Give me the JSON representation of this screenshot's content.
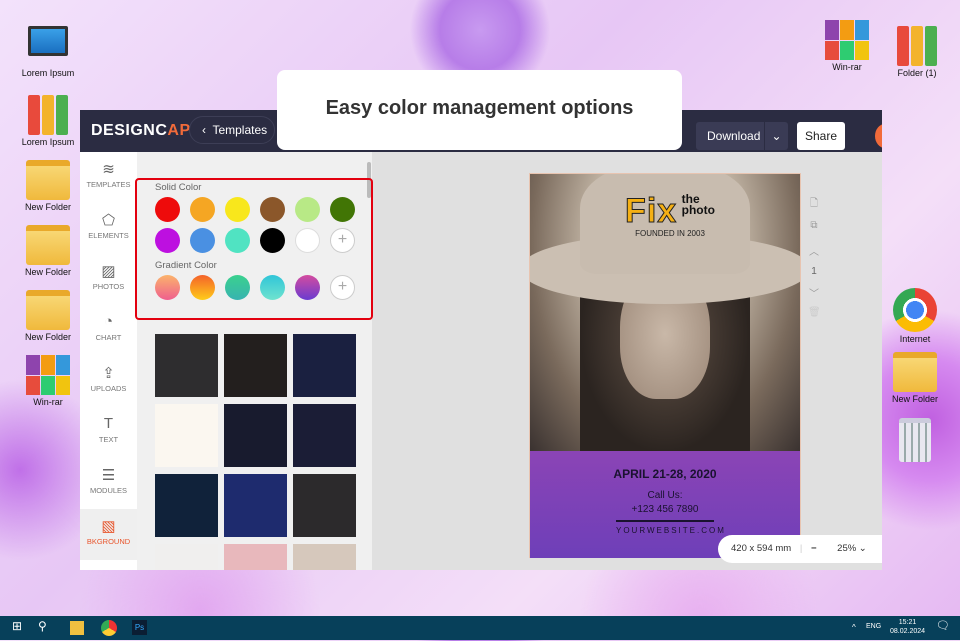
{
  "desktop": {
    "left": [
      {
        "label": "Lorem Ipsum",
        "icon": "computer-icon"
      },
      {
        "label": "Lorem Ipsum",
        "icon": "binders-icon"
      },
      {
        "label": "New Folder",
        "icon": "folder-icon"
      },
      {
        "label": "New Folder",
        "icon": "folder-icon"
      },
      {
        "label": "New Folder",
        "icon": "folder-icon"
      },
      {
        "label": "Win-rar",
        "icon": "winrar-icon"
      }
    ],
    "right": [
      {
        "label": "Win-rar",
        "icon": "winrar-icon"
      },
      {
        "label": "Folder (1)",
        "icon": "binders-icon"
      },
      {
        "label": "Internet",
        "icon": "chrome-icon"
      },
      {
        "label": "New Folder",
        "icon": "folder-icon"
      },
      {
        "label": "",
        "icon": "recycle-bin-icon"
      }
    ]
  },
  "callout": "Easy color management options",
  "app": {
    "logo_a": "DESIGNC",
    "logo_b": "AP",
    "templates_btn": "Templates",
    "download": "Download",
    "share": "Share"
  },
  "sidebar": [
    {
      "label": "TEMPLATES",
      "icon": "≋"
    },
    {
      "label": "ELEMENTS",
      "icon": "⬠"
    },
    {
      "label": "PHOTOS",
      "icon": "▨"
    },
    {
      "label": "CHART",
      "icon": "◔"
    },
    {
      "label": "UPLOADS",
      "icon": "⇪"
    },
    {
      "label": "TEXT",
      "icon": "T"
    },
    {
      "label": "MODULES",
      "icon": "☰"
    },
    {
      "label": "BKGROUND",
      "icon": "▧"
    }
  ],
  "panel": {
    "solid_label": "Solid Color",
    "gradient_label": "Gradient Color",
    "add": "+",
    "solid": [
      "#ee0b0b",
      "#f5a623",
      "#f8e71c",
      "#8b572a",
      "#b8e986",
      "#417505",
      "#bd10e0",
      "#4a90e2",
      "#50e3c2",
      "#000000",
      "#ffffff"
    ],
    "gradients": [
      [
        "#fbb36b",
        "#ef5f8e"
      ],
      [
        "#f4622a",
        "#ffcc1a"
      ],
      [
        "#3ad18e",
        "#38b3b0"
      ],
      [
        "#30c5d8",
        "#6fe3cf"
      ],
      [
        "#d44c9f",
        "#6a3bd0"
      ]
    ],
    "tiles": [
      "#2e2d2f",
      "#231f1e",
      "#1a2040",
      "#fbf7f0",
      "#181b2e",
      "#1b1d36",
      "#10223a",
      "#1e2b6e",
      "#2c2a2c",
      "#f0efee",
      "#e8b8bc",
      "#d6c8bc"
    ]
  },
  "poster": {
    "brand": "Fix",
    "brand_sub1": "the",
    "brand_sub2": "photo",
    "founded": "FOUNDED IN 2003",
    "date": "APRIL 21-28, 2020",
    "call": "Call Us:",
    "phone": "+123 456 7890",
    "website": "YOURWEBSITE.COM"
  },
  "page_tools": {
    "page": "1"
  },
  "zoombar": {
    "size": "420 x 594 mm",
    "minus": "−",
    "zoom": "25%"
  },
  "taskbar": {
    "lang": "ENG",
    "time": "15:21",
    "date": "08.02.2024"
  }
}
